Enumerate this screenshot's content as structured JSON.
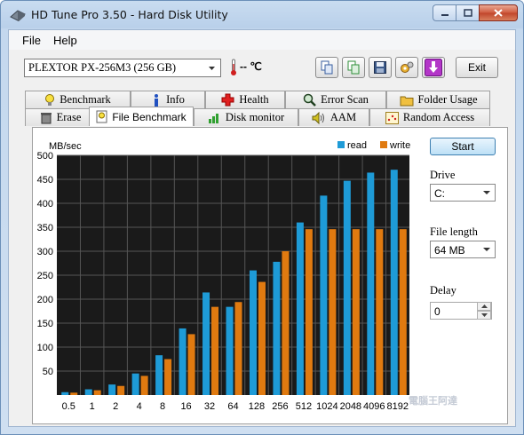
{
  "window": {
    "title": "HD Tune Pro 3.50 - Hard Disk Utility",
    "caption_buttons": [
      "minimize-icon",
      "maximize-icon",
      "close-icon"
    ]
  },
  "menu": {
    "file": "File",
    "help": "Help"
  },
  "toolbar": {
    "drive": "PLEXTOR  PX-256M3 (256 GB)",
    "temperature": "-- ℃",
    "buttons": [
      "copy-info-icon",
      "copy-info-icon",
      "save-icon",
      "options-icon",
      "download-icon"
    ],
    "exit_label": "Exit"
  },
  "tabs": {
    "row1": [
      "Benchmark",
      "Info",
      "Health",
      "Error Scan",
      "Folder Usage"
    ],
    "row2": [
      "Erase",
      "File Benchmark",
      "Disk monitor",
      "AAM",
      "Random Access"
    ],
    "active": "File Benchmark"
  },
  "controls": {
    "start_label": "Start",
    "drive_label": "Drive",
    "drive_value": "C:",
    "file_length_label": "File length",
    "file_length_value": "64 MB",
    "delay_label": "Delay",
    "delay_value": "0"
  },
  "colors": {
    "read": "#1e9bd7",
    "write": "#e07a10",
    "plot_bg": "#1a1a1a"
  },
  "watermark": "電腦王阿達",
  "chart_data": {
    "type": "bar",
    "ylabel": "MB/sec",
    "ylim": [
      0,
      500
    ],
    "yticks": [
      50,
      100,
      150,
      200,
      250,
      300,
      350,
      400,
      450,
      500
    ],
    "categories": [
      "0.5",
      "1",
      "2",
      "4",
      "8",
      "16",
      "32",
      "64",
      "128",
      "256",
      "512",
      "1024",
      "2048",
      "4096",
      "8192"
    ],
    "series": [
      {
        "name": "read",
        "values": [
          6,
          12,
          22,
          45,
          83,
          139,
          214,
          184,
          260,
          278,
          360,
          416,
          447,
          464,
          470
        ]
      },
      {
        "name": "write",
        "values": [
          5,
          10,
          19,
          40,
          75,
          127,
          184,
          194,
          236,
          300,
          346,
          346,
          346,
          346,
          346
        ]
      }
    ],
    "legend_position": "top-right",
    "grid": true
  }
}
